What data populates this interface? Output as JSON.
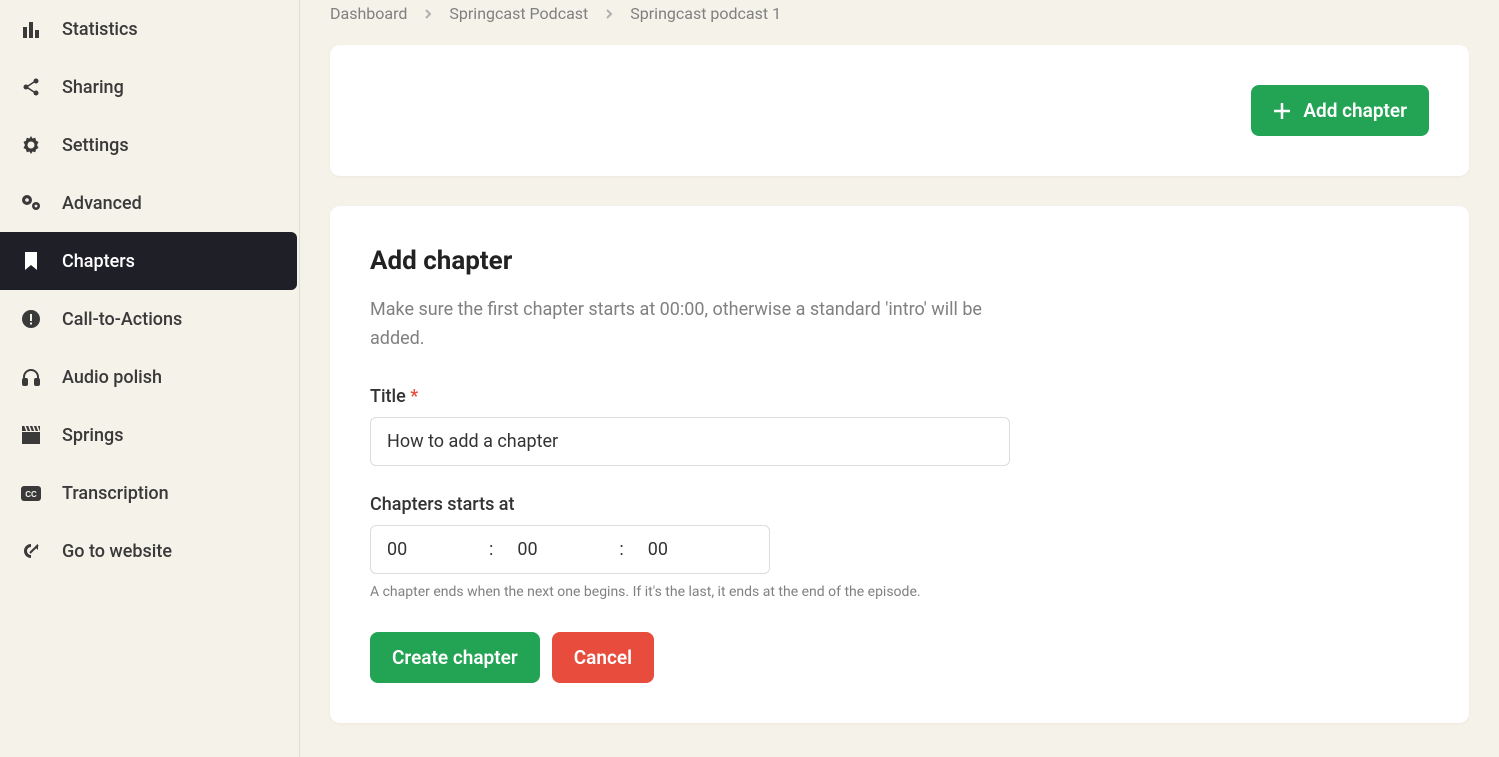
{
  "sidebar": {
    "items": [
      {
        "label": "Statistics"
      },
      {
        "label": "Sharing"
      },
      {
        "label": "Settings"
      },
      {
        "label": "Advanced"
      },
      {
        "label": "Chapters"
      },
      {
        "label": "Call-to-Actions"
      },
      {
        "label": "Audio polish"
      },
      {
        "label": "Springs"
      },
      {
        "label": "Transcription"
      },
      {
        "label": "Go to website"
      }
    ]
  },
  "breadcrumb": {
    "items": [
      "Dashboard",
      "Springcast Podcast",
      "Springcast podcast 1"
    ]
  },
  "toolbar": {
    "add_chapter_label": "Add chapter"
  },
  "form": {
    "heading": "Add chapter",
    "description": "Make sure the first chapter starts at 00:00, otherwise a standard 'intro' will be added.",
    "title_label": "Title",
    "title_value": "How to add a chapter",
    "starts_at_label": "Chapters starts at",
    "time_hh": "00",
    "time_mm": "00",
    "time_ss": "00",
    "help_text": "A chapter ends when the next one begins. If it's the last, it ends at the end of the episode.",
    "submit_label": "Create chapter",
    "cancel_label": "Cancel"
  }
}
